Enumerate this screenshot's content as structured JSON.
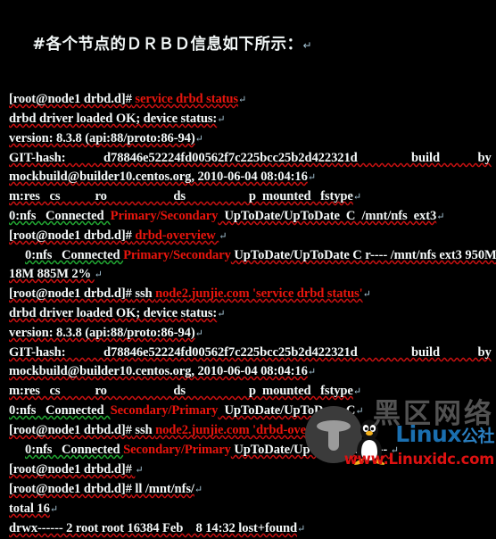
{
  "heading": {
    "text": "#各个节点的ＤＲＢＤ信息如下所示：",
    "pilcrow": "↵"
  },
  "prompt": "[root@node1 drbd.d]#",
  "return_mark": "↵",
  "lines": [
    {
      "id": "cmd-service-drbd-status",
      "kind": "command",
      "prompt": "[root@node1 drbd.d]#",
      "command": " service drbd status",
      "mark": "↵"
    },
    {
      "id": "out-driver-loaded-1",
      "kind": "output",
      "text": "drbd driver loaded OK; device status:",
      "mark": "↵"
    },
    {
      "id": "out-version-1",
      "kind": "output",
      "text": "version: 8.3.8 (api:88/proto:86-94)",
      "mark": "↵"
    },
    {
      "id": "out-githash-1",
      "kind": "output",
      "text": "GIT-hash:            d78846e52224fd00562f7c225bcc25b2d422321d                 build            by",
      "mark": ""
    },
    {
      "id": "out-mockbuild-1",
      "kind": "output",
      "text": "mockbuild@builder10.centos.org, 2010-06-04 08:04:16",
      "mark": "↵"
    },
    {
      "id": "out-table-header-1",
      "kind": "output",
      "text": "m:res   cs           ro                     ds                    p  mounted   fstype",
      "mark": "↵"
    },
    {
      "id": "out-status-row-1",
      "kind": "status",
      "before": "0:nfs   Connected  ",
      "role": "Primary/Secondary",
      "after": "  UpToDate/UpToDate  C  /mnt/nfs  ext3",
      "mark": "↵"
    },
    {
      "id": "cmd-drbd-overview-1",
      "kind": "command",
      "prompt": "[root@node1 drbd.d]#",
      "command": " drbd-overview ",
      "mark": "↵"
    },
    {
      "id": "out-overview-row-1",
      "kind": "status",
      "indent": true,
      "before": "0:nfs   Connected ",
      "role": "Primary/Secondary",
      "after": " UpToDate/UpToDate C r---- /mnt/nfs ext3 950M",
      "mark": ""
    },
    {
      "id": "out-overview-row-1-wrap",
      "kind": "output",
      "text": "18M 885M 2% ",
      "mark": "↵"
    },
    {
      "id": "cmd-ssh-service-status",
      "kind": "command-ssh",
      "prompt": "[root@node1 drbd.d]#",
      "keyword": " ssh ",
      "command": "node2.junjie.com 'service drbd status'",
      "mark": "↵"
    },
    {
      "id": "out-driver-loaded-2",
      "kind": "output",
      "text": "drbd driver loaded OK; device status:",
      "mark": "↵"
    },
    {
      "id": "out-version-2",
      "kind": "output",
      "text": "version: 8.3.8 (api:88/proto:86-94)",
      "mark": "↵"
    },
    {
      "id": "out-githash-2",
      "kind": "output",
      "text": "GIT-hash:            d78846e52224fd00562f7c225bcc25b2d422321d                 build            by",
      "mark": ""
    },
    {
      "id": "out-mockbuild-2",
      "kind": "output",
      "text": "mockbuild@builder10.centos.org, 2010-06-04 08:04:16",
      "mark": "↵"
    },
    {
      "id": "out-table-header-2",
      "kind": "output",
      "text": "m:res   cs           ro                     ds                    p  mounted   fstype",
      "mark": "↵"
    },
    {
      "id": "out-status-row-2",
      "kind": "status",
      "before": "0:nfs   Connected  ",
      "role": "Secondary/Primary",
      "after": "  UpToDate/UpToDate  C",
      "mark": "↵"
    },
    {
      "id": "cmd-ssh-drbd-overview",
      "kind": "command-ssh",
      "prompt": "[root@node1 drbd.d]#",
      "keyword": " ssh ",
      "command": "node2.junjie.com 'drbd-overview'",
      "mark": "↵"
    },
    {
      "id": "out-overview-row-2",
      "kind": "status",
      "indent": true,
      "before": "0:nfs   Connected ",
      "role": "Secondary/Primary",
      "after": " UpToDate/UpToDate C r---- ",
      "mark": "↵"
    },
    {
      "id": "cmd-empty",
      "kind": "command",
      "prompt": "[root@node1 drbd.d]#",
      "command": " ",
      "mark": "↵"
    },
    {
      "id": "cmd-ll-mnt-nfs",
      "kind": "command-plain",
      "prompt": "[root@node1 drbd.d]#",
      "command": " ll /mnt/nfs/",
      "mark": "↵"
    },
    {
      "id": "out-total",
      "kind": "output",
      "text": "total 16",
      "mark": "↵"
    },
    {
      "id": "out-lost-found",
      "kind": "output",
      "text": "drwx------ 2 root root 16384 Feb    8 14:32 lost+found",
      "mark": "↵"
    }
  ],
  "watermark": {
    "cn_text": "黑区网络",
    "brand": "Linux",
    "brand_sub": "公社",
    "url": "www.Linuxidc.com"
  },
  "colors": {
    "background": "#000000",
    "text": "#f4f8f8",
    "command": "#e8150d",
    "return_mark": "#a8c7d8",
    "watermark_blue": "#1a6fb0",
    "watermark_red": "#dd1111",
    "watermark_gray": "#5a5a5a"
  }
}
